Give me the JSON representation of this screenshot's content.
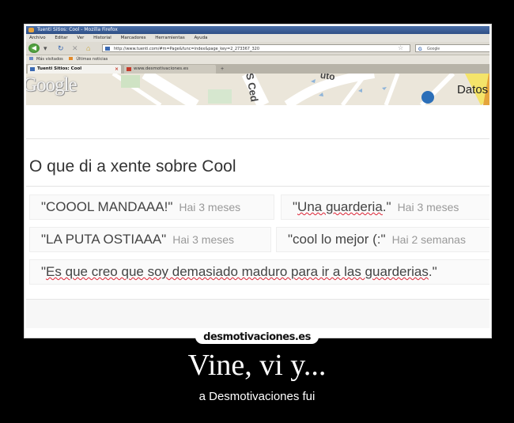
{
  "browser": {
    "window_title": "Tuenti Sitios: Cool - Mozilla Firefox",
    "menu": [
      "Archivo",
      "Editar",
      "Ver",
      "Historial",
      "Marcadores",
      "Herramientas",
      "Ayuda"
    ],
    "url": "http://www.tuenti.com/#m=Page&func=index&page_key=2_273367_320",
    "search_placeholder": "Google",
    "search_engine_letter": "G",
    "bookmarks": [
      "Más visitados",
      "Últimas noticias"
    ],
    "tabs": [
      {
        "label": "Tuenti Sitios: Cool",
        "active": true
      },
      {
        "label": "www.desmotivaciones.es",
        "active": false
      }
    ],
    "tab_close_glyph": "×",
    "new_tab_glyph": "+",
    "star_glyph": "☆"
  },
  "map": {
    "logo": "Google",
    "label": "Datos",
    "street_1": "S Ced",
    "street_2": "uto"
  },
  "page": {
    "heading": "O que di a xente sobre Cool",
    "comments": [
      {
        "pre": "\"COOOL MANDAAA!\"",
        "underlined": "",
        "post": "",
        "time": "Hai 3 meses"
      },
      {
        "pre": "\"",
        "underlined": "Una guarderia",
        "post": ".\"",
        "time": "Hai 3 meses"
      },
      {
        "pre": "\"LA PUTA OSTIAAA\"",
        "underlined": "",
        "post": "",
        "time": "Hai 3 meses"
      },
      {
        "pre": "\"cool lo mejor (:\"",
        "underlined": "",
        "post": "",
        "time": "Hai 2 semanas"
      },
      {
        "pre": "\"",
        "underlined": "Es que creo que soy demasiado maduro para ir a las guarderias",
        "post": ".\"",
        "time": ""
      }
    ]
  },
  "poster": {
    "watermark": "desmotivaciones.es",
    "title": "Vine, vi y...",
    "subtitle": "a Desmotivaciones fui"
  }
}
